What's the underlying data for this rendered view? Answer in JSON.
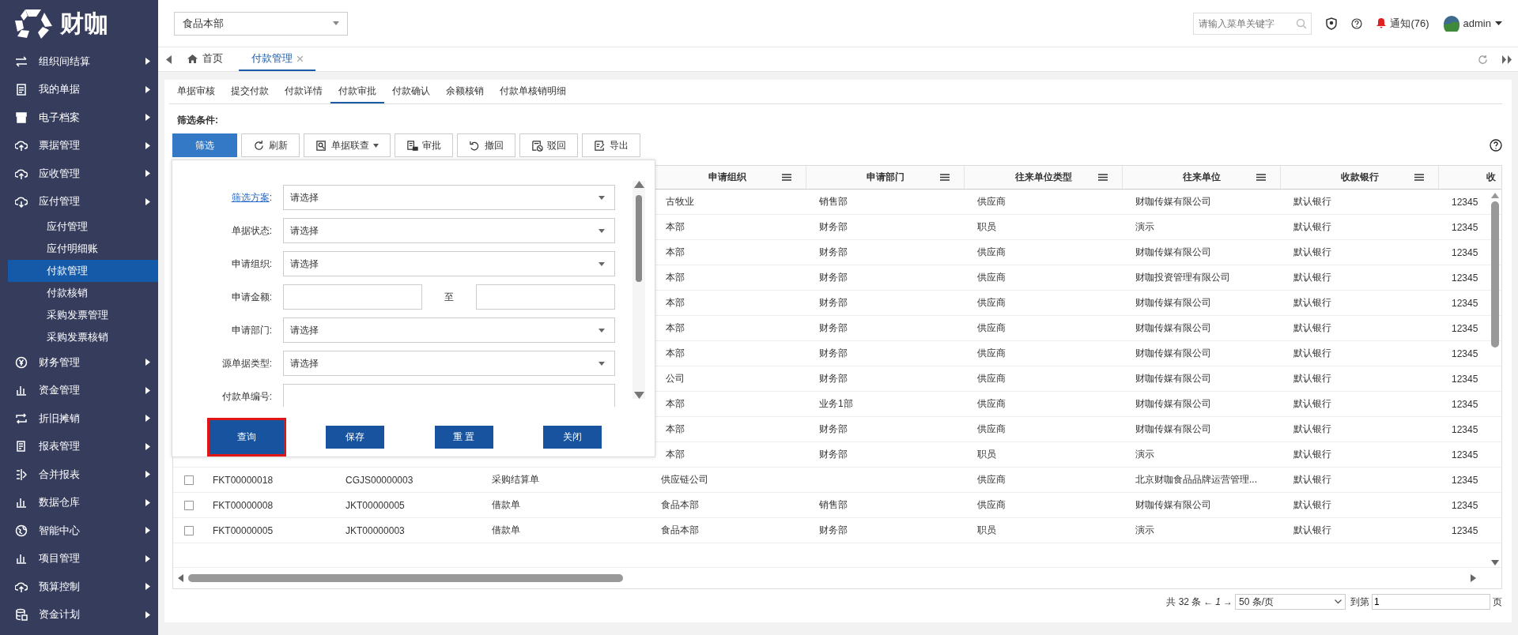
{
  "logo": "财咖",
  "sidebar": {
    "items": [
      {
        "label": "组织间结算"
      },
      {
        "label": "我的单据"
      },
      {
        "label": "电子档案"
      },
      {
        "label": "票据管理"
      },
      {
        "label": "应收管理"
      },
      {
        "label": "应付管理",
        "children": [
          {
            "label": "应付管理",
            "selected": false
          },
          {
            "label": "应付明细账",
            "selected": false
          },
          {
            "label": "付款管理",
            "selected": true
          },
          {
            "label": "付款核销",
            "selected": false
          },
          {
            "label": "采购发票管理",
            "selected": false
          },
          {
            "label": "采购发票核销",
            "selected": false
          }
        ]
      },
      {
        "label": "财务管理"
      },
      {
        "label": "资金管理"
      },
      {
        "label": "折旧摊销"
      },
      {
        "label": "报表管理"
      },
      {
        "label": "合并报表"
      },
      {
        "label": "数据仓库"
      },
      {
        "label": "智能中心"
      },
      {
        "label": "项目管理"
      },
      {
        "label": "预算控制"
      },
      {
        "label": "资金计划"
      }
    ]
  },
  "header": {
    "org_select": "食品本部",
    "search": {
      "placeholder": "请输入菜单关键字"
    },
    "notice": "通知(76)",
    "user": "admin"
  },
  "tabs": [
    {
      "label": "首页",
      "kind": "home",
      "selected": false
    },
    {
      "label": "付款管理",
      "kind": "page",
      "selected": true
    }
  ],
  "subtabs": [
    {
      "label": "单据审核",
      "selected": false
    },
    {
      "label": "提交付款",
      "selected": false
    },
    {
      "label": "付款详情",
      "selected": false
    },
    {
      "label": "付款审批",
      "selected": true
    },
    {
      "label": "付款确认",
      "selected": false
    },
    {
      "label": "余额核销",
      "selected": false
    },
    {
      "label": "付款单核销明细",
      "selected": false
    }
  ],
  "filter_title": "筛选条件:",
  "toolbar": [
    {
      "label": "筛选",
      "kind": "primary"
    },
    {
      "label": "刷新",
      "kind": "refresh"
    },
    {
      "label": "单据联查",
      "kind": "query"
    },
    {
      "label": "审批",
      "kind": "approve"
    },
    {
      "label": "撤回",
      "kind": "withdraw"
    },
    {
      "label": "驳回",
      "kind": "reject"
    },
    {
      "label": "导出",
      "kind": "export"
    }
  ],
  "table": {
    "columns": [
      "申请组织",
      "申请部门",
      "往来单位类型",
      "往来单位",
      "收款银行",
      "收"
    ],
    "rows": [
      {
        "org": "古牧业",
        "dept": "销售部",
        "partner_type": "供应商",
        "partner": "财咖传媒有限公司",
        "bank": "默认银行",
        "column_10": "12345"
      },
      {
        "org": "本部",
        "dept": "财务部",
        "partner_type": "职员",
        "partner": "演示",
        "bank": "默认银行",
        "column_10": "12345"
      },
      {
        "org": "本部",
        "dept": "财务部",
        "partner_type": "供应商",
        "partner": "财咖传媒有限公司",
        "bank": "默认银行",
        "column_10": "12345"
      },
      {
        "org": "本部",
        "dept": "财务部",
        "partner_type": "供应商",
        "partner": "财咖投资管理有限公司",
        "bank": "默认银行",
        "column_10": "12345"
      },
      {
        "org": "本部",
        "dept": "财务部",
        "partner_type": "供应商",
        "partner": "财咖传媒有限公司",
        "bank": "默认银行",
        "column_10": "12345"
      },
      {
        "org": "本部",
        "dept": "财务部",
        "partner_type": "供应商",
        "partner": "财咖传媒有限公司",
        "bank": "默认银行",
        "column_10": "12345"
      },
      {
        "org": "本部",
        "dept": "财务部",
        "partner_type": "供应商",
        "partner": "财咖传媒有限公司",
        "bank": "默认银行",
        "column_10": "12345"
      },
      {
        "org": "公司",
        "dept": "财务部",
        "partner_type": "供应商",
        "partner": "财咖传媒有限公司",
        "bank": "默认银行",
        "column_10": "12345"
      },
      {
        "org": "本部",
        "dept": "业务1部",
        "partner_type": "供应商",
        "partner": "财咖传媒有限公司",
        "bank": "默认银行",
        "column_10": "12345"
      },
      {
        "org": "本部",
        "dept": "财务部",
        "partner_type": "供应商",
        "partner": "财咖传媒有限公司",
        "bank": "默认银行",
        "column_10": "12345"
      },
      {
        "org": "本部",
        "dept": "财务部",
        "partner_type": "职员",
        "partner": "演示",
        "bank": "默认银行",
        "column_10": "12345"
      },
      {
        "checked": false,
        "number": "FKT00000018",
        "source_no": "CGJS00000003",
        "source_type": "采购结算单",
        "org": "供应链公司",
        "partner_type": "供应商",
        "partner": "北京财咖食品品牌运营管理...",
        "bank": "默认银行",
        "column_10": "12345"
      },
      {
        "checked": false,
        "number": "FKT00000008",
        "source_no": "JKT00000005",
        "source_type": "借款单",
        "org": "食品本部",
        "dept": "销售部",
        "partner_type": "供应商",
        "partner": "财咖传媒有限公司",
        "bank": "默认银行",
        "column_10": "12345"
      },
      {
        "checked": false,
        "number": "FKT00000005",
        "source_no": "JKT00000003",
        "source_type": "借款单",
        "org": "食品本部",
        "dept": "财务部",
        "partner_type": "职员",
        "partner": "演示",
        "bank": "默认银行",
        "column_10": "12345"
      }
    ]
  },
  "filter_panel": {
    "fields": [
      {
        "label": "筛选方案",
        "colon": ":",
        "link": true,
        "kind": "select",
        "value": "请选择"
      },
      {
        "label": "单据状态",
        "colon": ":",
        "link": false,
        "kind": "select",
        "value": "请选择"
      },
      {
        "label": "申请组织",
        "colon": ":",
        "link": false,
        "kind": "select",
        "value": "请选择"
      },
      {
        "label": "申请金额",
        "colon": ":",
        "link": false,
        "kind": "range",
        "separator": "至"
      },
      {
        "label": "申请部门",
        "colon": ":",
        "link": false,
        "kind": "select",
        "value": "请选择"
      },
      {
        "label": "源单据类型",
        "colon": ":",
        "link": false,
        "kind": "select",
        "value": "请选择"
      },
      {
        "label": "付款单编号",
        "colon": ":",
        "link": false,
        "kind": "text"
      }
    ],
    "buttons": [
      {
        "label": "查询",
        "highlighted": true
      },
      {
        "label": "保存",
        "highlighted": false
      },
      {
        "label": "重 置",
        "highlighted": false
      },
      {
        "label": "关闭",
        "highlighted": false
      }
    ]
  },
  "pagination": {
    "total": "共 32 条",
    "prev": "←",
    "page": "1",
    "next": "→",
    "page_size": "50 条/页",
    "goto": "到第",
    "goto_value": "1",
    "suffix": "页"
  }
}
